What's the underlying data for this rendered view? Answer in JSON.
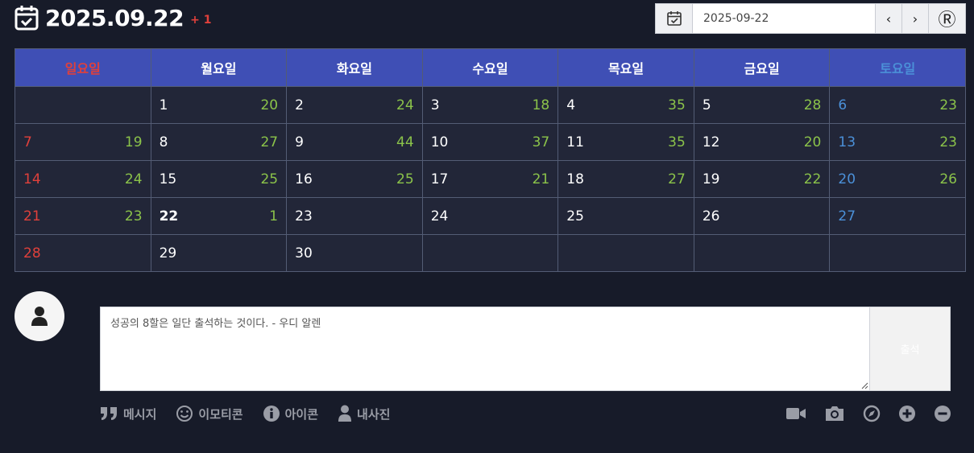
{
  "header": {
    "date": "2025.09.22",
    "count": "+ 1"
  },
  "datebar": {
    "value": "2025-09-22",
    "prev": "‹",
    "next": "›",
    "reset": "Ⓡ"
  },
  "weekdays": [
    "일요일",
    "월요일",
    "화요일",
    "수요일",
    "목요일",
    "금요일",
    "토요일"
  ],
  "weeks": [
    [
      {
        "d": "",
        "c": ""
      },
      {
        "d": "1",
        "c": "20"
      },
      {
        "d": "2",
        "c": "24"
      },
      {
        "d": "3",
        "c": "18"
      },
      {
        "d": "4",
        "c": "35"
      },
      {
        "d": "5",
        "c": "28"
      },
      {
        "d": "6",
        "c": "23"
      }
    ],
    [
      {
        "d": "7",
        "c": "19"
      },
      {
        "d": "8",
        "c": "27"
      },
      {
        "d": "9",
        "c": "44"
      },
      {
        "d": "10",
        "c": "37"
      },
      {
        "d": "11",
        "c": "35"
      },
      {
        "d": "12",
        "c": "20"
      },
      {
        "d": "13",
        "c": "23"
      }
    ],
    [
      {
        "d": "14",
        "c": "24"
      },
      {
        "d": "15",
        "c": "25"
      },
      {
        "d": "16",
        "c": "25"
      },
      {
        "d": "17",
        "c": "21"
      },
      {
        "d": "18",
        "c": "27"
      },
      {
        "d": "19",
        "c": "22"
      },
      {
        "d": "20",
        "c": "26"
      }
    ],
    [
      {
        "d": "21",
        "c": "23"
      },
      {
        "d": "22",
        "c": "1"
      },
      {
        "d": "23",
        "c": ""
      },
      {
        "d": "24",
        "c": ""
      },
      {
        "d": "25",
        "c": ""
      },
      {
        "d": "26",
        "c": ""
      },
      {
        "d": "27",
        "c": ""
      }
    ],
    [
      {
        "d": "28",
        "c": ""
      },
      {
        "d": "29",
        "c": ""
      },
      {
        "d": "30",
        "c": ""
      },
      {
        "d": "",
        "c": ""
      },
      {
        "d": "",
        "c": ""
      },
      {
        "d": "",
        "c": ""
      },
      {
        "d": "",
        "c": ""
      }
    ]
  ],
  "today": "22",
  "comment": {
    "value": "성공의 8할은 일단 출석하는 것이다. - 우디 알렌",
    "submit": "출석"
  },
  "tools": {
    "message": "메시지",
    "emoticon": "이모티콘",
    "icon": "아이콘",
    "photo": "내사진"
  },
  "colors": {
    "sunday": "#e0403b",
    "saturday": "#4b90d8",
    "count": "#8bc34a",
    "header": "#3f4fb5"
  }
}
